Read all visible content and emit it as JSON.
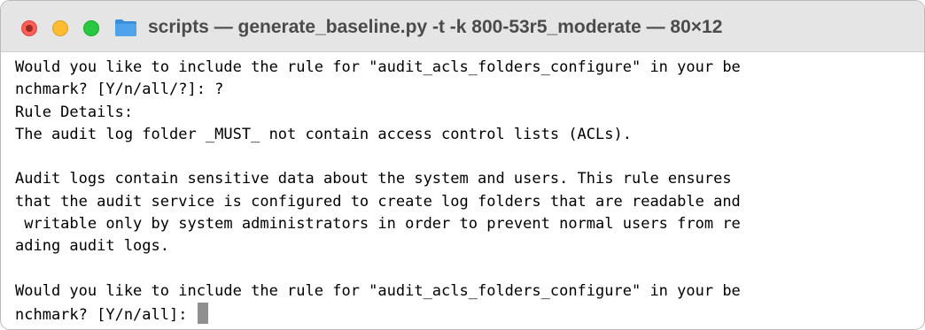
{
  "window": {
    "title": "scripts — generate_baseline.py -t -k 800-53r5_moderate — 80×12",
    "folder_icon": "folder-icon",
    "colors": {
      "close": "#fe5f57",
      "minimize": "#febc2e",
      "zoom": "#28c840",
      "folder": "#3b8fd9"
    }
  },
  "terminal": {
    "lines": [
      "Would you like to include the rule for \"audit_acls_folders_configure\" in your be",
      "nchmark? [Y/n/all/?]: ?",
      "Rule Details:",
      "The audit log folder _MUST_ not contain access control lists (ACLs).",
      "",
      "Audit logs contain sensitive data about the system and users. This rule ensures",
      "that the audit service is configured to create log folders that are readable and",
      " writable only by system administrators in order to prevent normal users from re",
      "ading audit logs.",
      "",
      "Would you like to include the rule for \"audit_acls_folders_configure\" in your be",
      "nchmark? [Y/n/all]: "
    ]
  }
}
